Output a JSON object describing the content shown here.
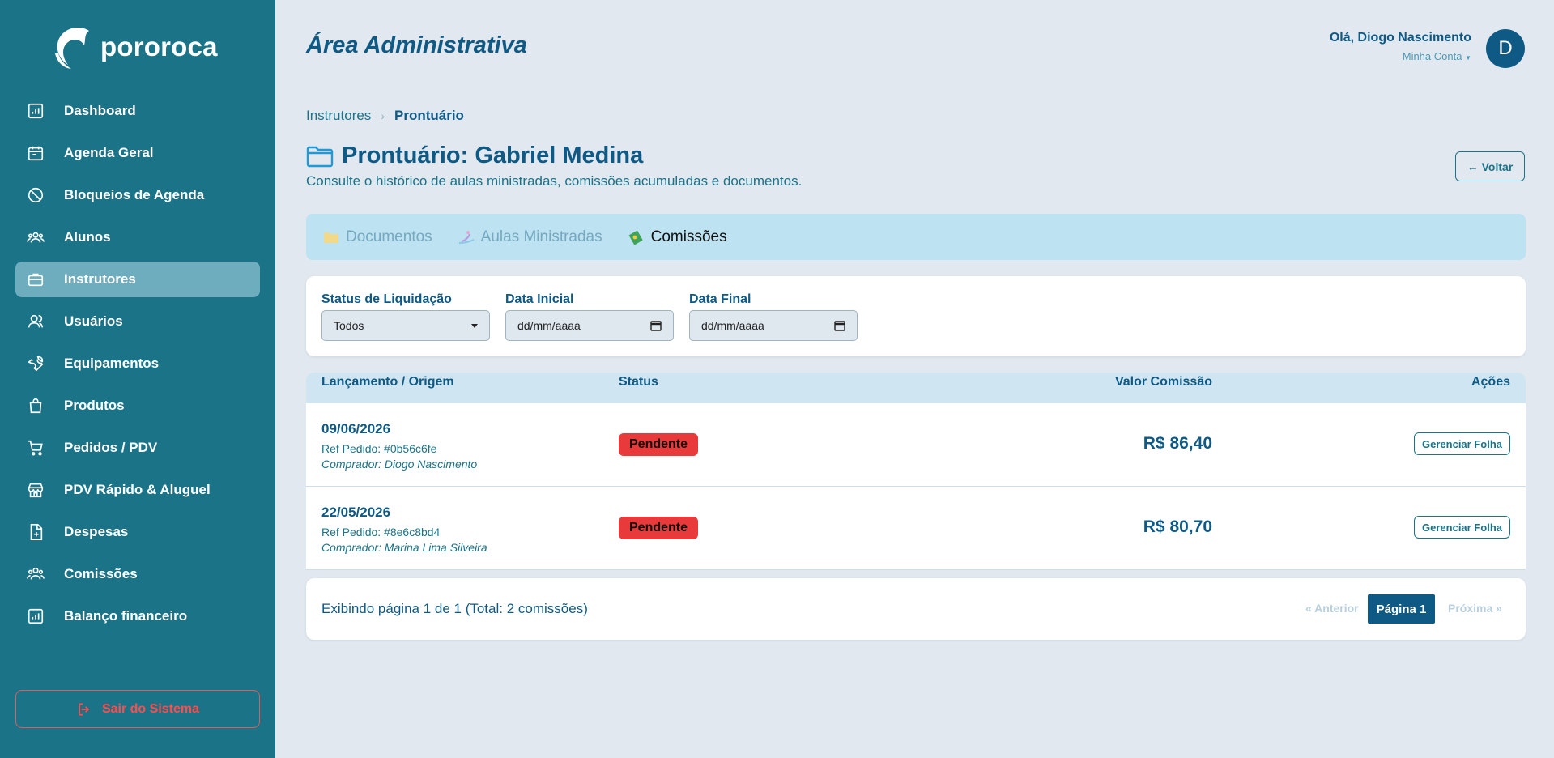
{
  "brand": {
    "name": "pororoca"
  },
  "sidebar": {
    "items": [
      {
        "label": "Dashboard",
        "icon": "chart-icon"
      },
      {
        "label": "Agenda Geral",
        "icon": "calendar-icon"
      },
      {
        "label": "Bloqueios de Agenda",
        "icon": "block-icon"
      },
      {
        "label": "Alunos",
        "icon": "students-icon"
      },
      {
        "label": "Instrutores",
        "icon": "briefcase-icon",
        "active": true
      },
      {
        "label": "Usuários",
        "icon": "users-icon"
      },
      {
        "label": "Equipamentos",
        "icon": "wrench-icon"
      },
      {
        "label": "Produtos",
        "icon": "bag-icon"
      },
      {
        "label": "Pedidos / PDV",
        "icon": "cart-icon"
      },
      {
        "label": "PDV Rápido & Aluguel",
        "icon": "store-icon"
      },
      {
        "label": "Despesas",
        "icon": "file-plus-icon"
      },
      {
        "label": "Comissões",
        "icon": "group-icon"
      },
      {
        "label": "Balanço financeiro",
        "icon": "chart-icon"
      }
    ],
    "logout_label": "Sair do Sistema"
  },
  "header": {
    "title": "Área Administrativa",
    "greeting": "Olá, Diogo Nascimento",
    "account": "Minha Conta",
    "avatar_letter": "D"
  },
  "breadcrumb": {
    "parent": "Instrutores",
    "current": "Prontuário"
  },
  "page": {
    "title": "Prontuário: Gabriel Medina",
    "subtitle": "Consulte o histórico de aulas ministradas, comissões acumuladas e documentos.",
    "back_label": "← Voltar"
  },
  "tabs": [
    {
      "label": "Documentos",
      "icon": "folder-icon"
    },
    {
      "label": "Aulas Ministradas",
      "icon": "surfer-icon"
    },
    {
      "label": "Comissões",
      "icon": "money-icon",
      "active": true
    }
  ],
  "filters": {
    "status_label": "Status de Liquidação",
    "status_value": "Todos",
    "start_label": "Data Inicial",
    "start_placeholder": "dd/mm/aaaa",
    "end_label": "Data Final",
    "end_placeholder": "dd/mm/aaaa"
  },
  "table": {
    "headers": [
      "Lançamento / Origem",
      "Status",
      "Valor Comissão",
      "Ações"
    ],
    "rows": [
      {
        "date": "09/06/2026",
        "ref": "Ref Pedido: #0b56c6fe",
        "buyer": "Comprador: Diogo Nascimento",
        "status": "Pendente",
        "value": "R$ 86,40",
        "action": "Gerenciar Folha"
      },
      {
        "date": "22/05/2026",
        "ref": "Ref Pedido: #8e6c8bd4",
        "buyer": "Comprador: Marina Lima Silveira",
        "status": "Pendente",
        "value": "R$ 80,70",
        "action": "Gerenciar Folha"
      }
    ]
  },
  "pagination": {
    "info": "Exibindo página 1 de 1 (Total: 2 comissões)",
    "prev": "« Anterior",
    "page": "Página 1",
    "next": "Próxima »"
  },
  "colors": {
    "sidebar_bg": "#1b7388",
    "primary": "#0f5a85",
    "status_pending": "#e83a3a",
    "logout": "#ff4d4d"
  }
}
